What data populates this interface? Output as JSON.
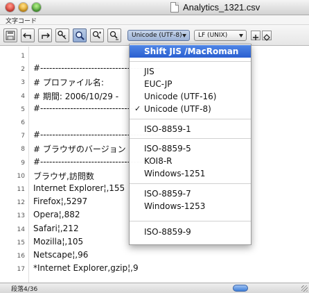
{
  "window": {
    "title": "Analytics_1321.csv"
  },
  "menubar": {
    "label": "文字コード"
  },
  "toolbar": {
    "encoding_value": "Unicode (UTF-8)",
    "lineending_value": "LF (UNIX)"
  },
  "editor": {
    "lines": [
      {
        "num": "1",
        "text": ""
      },
      {
        "num": "2",
        "text": "#----------------------------------------"
      },
      {
        "num": "3",
        "text": "# プロファイル名:"
      },
      {
        "num": "4",
        "text": "# 期間: 2006/10/29 -"
      },
      {
        "num": "5",
        "text": "#----------------------------------------"
      },
      {
        "num": "6",
        "text": ""
      },
      {
        "num": "7",
        "text": "#----------------------------------------"
      },
      {
        "num": "8",
        "text": "# ブラウザのバージョン"
      },
      {
        "num": "9",
        "text": "#----------------------------------------"
      },
      {
        "num": "10",
        "text": "ブラウザ,訪問数"
      },
      {
        "num": "11",
        "text": "Internet Explorer¦,155"
      },
      {
        "num": "12",
        "text": "Firefox¦,5297"
      },
      {
        "num": "13",
        "text": "Opera¦,882"
      },
      {
        "num": "14",
        "text": "Safari¦,212"
      },
      {
        "num": "15",
        "text": "Mozilla¦,105"
      },
      {
        "num": "16",
        "text": "Netscape¦,96"
      },
      {
        "num": "17",
        "text": "*Internet Explorer,gzip¦,9"
      }
    ]
  },
  "encoding_menu": {
    "items": [
      {
        "label": "Shift JIS /MacRoman",
        "highlighted": true,
        "checked": false
      },
      {
        "label": "JIS",
        "highlighted": false,
        "checked": false
      },
      {
        "label": "EUC-JP",
        "highlighted": false,
        "checked": false
      },
      {
        "label": "Unicode (UTF-16)",
        "highlighted": false,
        "checked": false
      },
      {
        "label": "Unicode (UTF-8)",
        "highlighted": false,
        "checked": true
      },
      {
        "label": "ISO-8859-1",
        "highlighted": false,
        "checked": false
      },
      {
        "label": "ISO-8859-5",
        "highlighted": false,
        "checked": false
      },
      {
        "label": "KOI8-R",
        "highlighted": false,
        "checked": false
      },
      {
        "label": "Windows-1251",
        "highlighted": false,
        "checked": false
      },
      {
        "label": "ISO-8859-7",
        "highlighted": false,
        "checked": false
      },
      {
        "label": "Windows-1253",
        "highlighted": false,
        "checked": false
      },
      {
        "label": "ISO-8859-9",
        "highlighted": false,
        "checked": false
      }
    ],
    "check_mark": "✓"
  },
  "statusbar": {
    "text": "段落4/36"
  },
  "colors": {
    "highlight": "#2a5fd0",
    "background": "#ffffff"
  }
}
